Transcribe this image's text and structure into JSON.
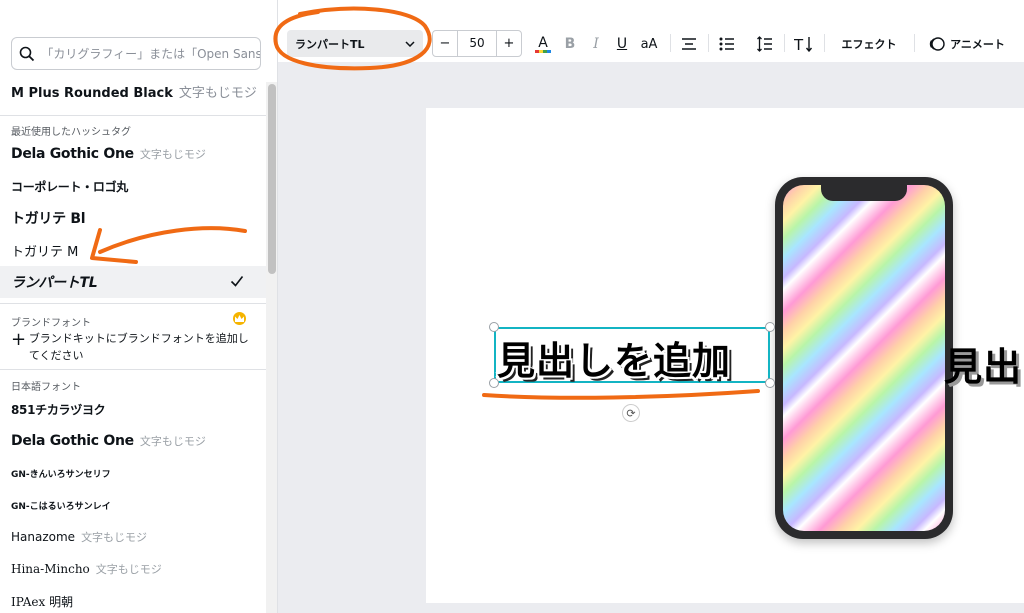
{
  "panel": {
    "search_placeholder": "「カリグラフィー」または「Open Sans」で検索",
    "current_font": {
      "name": "M Plus Rounded Black",
      "sample": "文字もじモジ"
    },
    "recent_label": "最近使用したハッシュタグ",
    "recent_fonts": [
      {
        "name": "Dela Gothic One",
        "sample": "文字もじモジ"
      },
      {
        "name": "コーポレート・ロゴ丸",
        "sample": ""
      },
      {
        "name": "トガリテ Bl",
        "sample": ""
      },
      {
        "name": "トガリテ M",
        "sample": ""
      },
      {
        "name": "ランパートTL",
        "sample": ""
      }
    ],
    "brand_label": "ブランドフォント",
    "brand_add_text": "ブランドキットにブランドフォントを追加してください",
    "japanese_label": "日本語フォント",
    "japanese_fonts": [
      {
        "name": "851チカラヅヨク",
        "sample": ""
      },
      {
        "name": "Dela Gothic One",
        "sample": "文字もじモジ"
      },
      {
        "name": "GN-きんいろサンセリフ",
        "sample": ""
      },
      {
        "name": "GN-こはるいろサンレイ",
        "sample": ""
      },
      {
        "name": "Hanazome",
        "sample": "文字もじモジ"
      },
      {
        "name": "Hina-Mincho",
        "sample": "文字もじモジ"
      },
      {
        "name": "IPAex 明朝",
        "sample": ""
      }
    ]
  },
  "toolbar": {
    "font_select": "ランパートTL",
    "font_size": "50",
    "minus": "−",
    "plus": "+",
    "case_label": "aA",
    "effects_label": "エフェクト",
    "animate_label": "アニメート"
  },
  "canvas": {
    "heading_text": "見出しを追加",
    "heading_partial": "見出"
  },
  "colors": {
    "annotation": "#f06a14",
    "selection": "#13b4c3",
    "crown": "#f5b400"
  }
}
